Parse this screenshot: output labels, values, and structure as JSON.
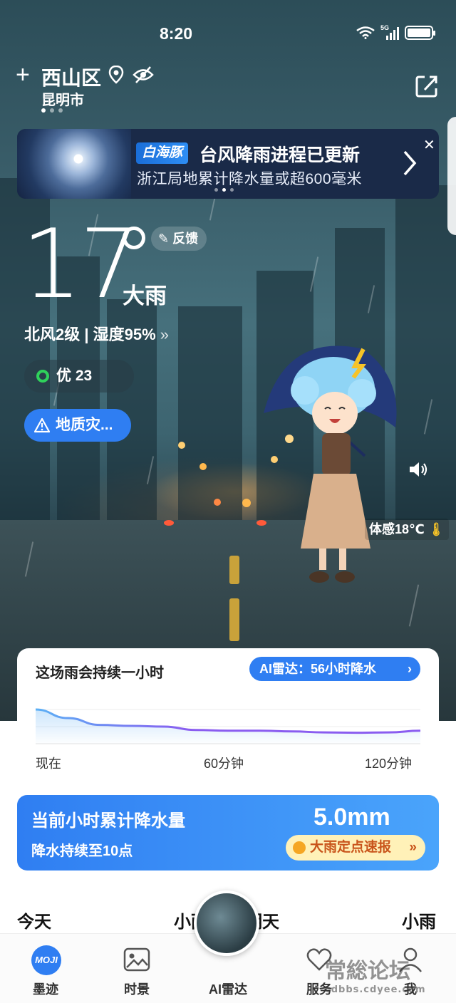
{
  "status_bar": {
    "time": "8:20",
    "network": "5G"
  },
  "location": {
    "district": "西山区",
    "city": "昆明市"
  },
  "banner": {
    "brand": "白海豚",
    "title": "台风降雨进程已更新",
    "subtitle": "浙江局地累计降水量或超600毫米"
  },
  "current": {
    "temperature": "17",
    "feedback_label": "反馈",
    "condition": "大雨",
    "wind_humidity": "北风2级 | 湿度95%",
    "aqi": "优 23",
    "alert": "地质灾...",
    "feels_like": "体感18℃"
  },
  "rain_card": {
    "title": "这场雨会持续一小时",
    "ai_radar_button": "AI雷达：56小时降水",
    "axis_labels": [
      "现在",
      "60分钟",
      "120分钟"
    ],
    "chart_data": {
      "type": "area",
      "x": [
        0,
        10,
        20,
        30,
        40,
        50,
        60,
        70,
        80,
        90,
        100,
        110,
        120
      ],
      "values": [
        1.0,
        0.75,
        0.55,
        0.52,
        0.5,
        0.4,
        0.38,
        0.38,
        0.36,
        0.33,
        0.32,
        0.33,
        0.38
      ],
      "xlabel": "",
      "ylabel": ""
    }
  },
  "precip_card": {
    "title": "当前小时累计降水量",
    "duration": "降水持续至10点",
    "amount": "5.0mm",
    "button": "大雨定点速报"
  },
  "forecast": {
    "today": "今天",
    "today_cond": "小雨",
    "tomorrow_suffix": "明天",
    "tomorrow_cond": "小雨"
  },
  "nav": {
    "items": [
      {
        "label": "墨迹"
      },
      {
        "label": "时景"
      },
      {
        "label": "AI雷达"
      },
      {
        "label": "服务"
      },
      {
        "label": "我"
      }
    ],
    "moji_logo": "MOJI"
  },
  "watermark": {
    "text": "常総论坛",
    "url": "cdbbs.cdyee.com"
  },
  "colors": {
    "accent": "#2f7ef2",
    "aqi_good": "#2fd25b",
    "curve": "#8a5cf0"
  }
}
